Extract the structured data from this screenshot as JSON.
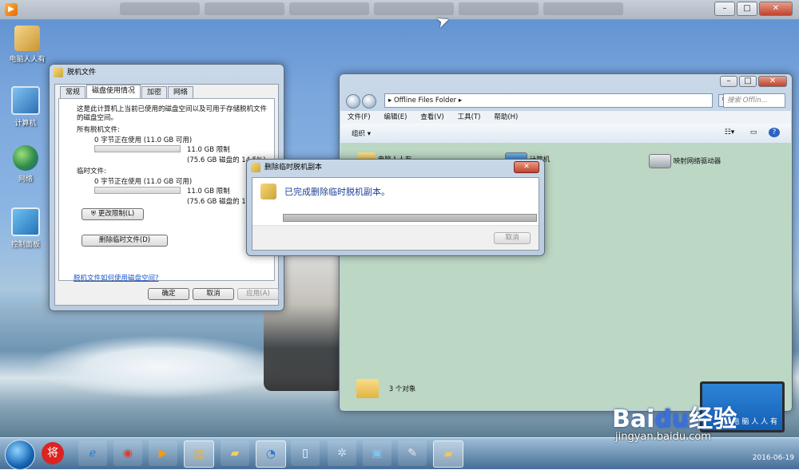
{
  "desktop": {
    "icons": [
      {
        "label": "电脑人人有",
        "icon": "user-folder-icon"
      },
      {
        "label": "计算机",
        "icon": "computer-icon"
      },
      {
        "label": "网络",
        "icon": "network-icon"
      },
      {
        "label": "控制面板",
        "icon": "control-panel-icon"
      }
    ]
  },
  "props_dialog": {
    "title": "脱机文件",
    "tabs": [
      "常规",
      "磁盘使用情况",
      "加密",
      "网络"
    ],
    "active_tab": "磁盘使用情况",
    "intro": "这是此计算机上当前已使用的磁盘空间以及可用于存储脱机文件的磁盘空间。",
    "intro_line1": "这是此计算机上当前已使用的磁盘空间以及可用于存储脱机文件",
    "intro_line2": "的磁盘空间。",
    "all_files_label": "所有脱机文件:",
    "all_files_usage": "0 字节正在使用 (11.0 GB 可用)",
    "all_files_limit": "11.0 GB 限制",
    "all_files_share": "(75.6 GB 磁盘的 14.5%)",
    "temp_label": "临时文件:",
    "temp_usage": "0 字节正在使用 (11.0 GB 可用)",
    "temp_limit": "11.0 GB 限制",
    "temp_share": "(75.6 GB 磁盘的 14.",
    "change_limit_btn": "更改限制(L)",
    "delete_temp_btn": "删除临时文件(D)",
    "help_link": "脱机文件如何使用磁盘空间?",
    "ok": "确定",
    "cancel": "取消",
    "apply": "应用(A)"
  },
  "explorer": {
    "address": "Offline Files Folder",
    "search_placeholder": "搜索 Offlin...",
    "menu": [
      "文件(F)",
      "编辑(E)",
      "查看(V)",
      "工具(T)",
      "帮助(H)"
    ],
    "organize": "组织",
    "items": [
      {
        "label": "电脑人人有",
        "icon": "folder-icon"
      },
      {
        "label": "计算机",
        "icon": "computer-icon"
      },
      {
        "label": "映射网络驱动器",
        "icon": "network-drive-icon"
      }
    ],
    "status": "3 个对象"
  },
  "progress_dialog": {
    "title": "删除临时脱机副本",
    "message": "已完成删除临时脱机副本。",
    "progress": 1.0,
    "cancel": "取消"
  },
  "taskbar": {
    "apps": [
      "start-orb",
      "jiang-app-icon",
      "ie-icon",
      "chrome-icon",
      "media-player-icon",
      "explorer-icon",
      "folder-icon",
      "sync-app-icon",
      "document-icon",
      "gear-app-icon",
      "screen-icon",
      "paint-icon",
      "offline-files-icon"
    ],
    "clock": "2016-06-19"
  },
  "watermark": {
    "brand_left": "Bai",
    "brand_right": "经验",
    "site": "jingyan.baidu.com",
    "laptop_text": "电 脑 人 人 有"
  }
}
